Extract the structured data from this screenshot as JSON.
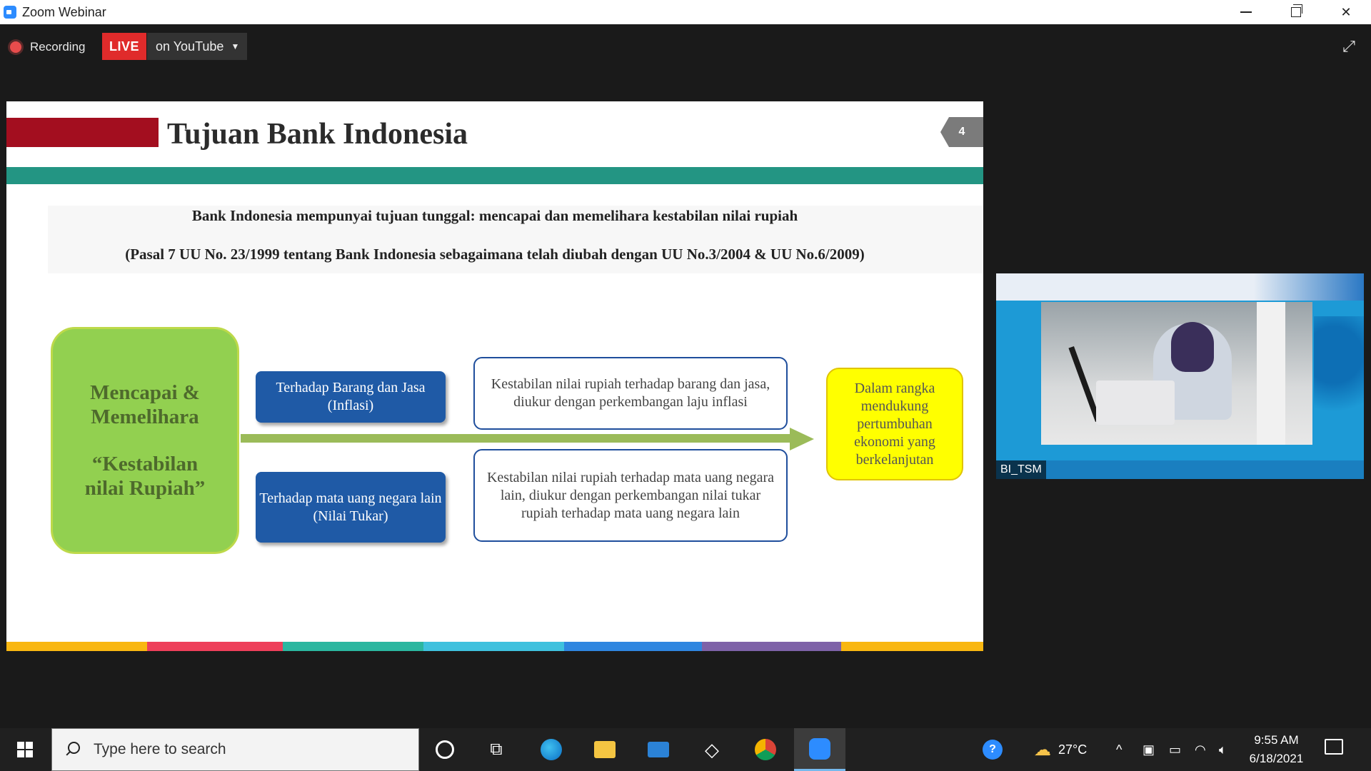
{
  "window": {
    "title": "Zoom Webinar"
  },
  "toolbar": {
    "recording_label": "Recording",
    "live_label": "LIVE",
    "stream_target": "on YouTube"
  },
  "slide": {
    "title": "Tujuan Bank Indonesia",
    "page_number": "4",
    "statement": "Bank Indonesia mempunyai tujuan tunggal: mencapai dan memelihara kestabilan nilai rupiah",
    "legal_basis": "(Pasal 7 UU No. 23/1999 tentang Bank Indonesia sebagaimana telah diubah dengan UU No.3/2004 & UU No.6/2009)",
    "goal_line1": "Mencapai &",
    "goal_line2": "Memelihara",
    "goal_line3": "“Kestabilan",
    "goal_line4": "nilai Rupiah”",
    "aspect_goods": "Terhadap Barang dan Jasa (Inflasi)",
    "aspect_currency": "Terhadap mata uang negara lain (Nilai Tukar)",
    "desc_goods": "Kestabilan nilai rupiah terhadap barang dan jasa, diukur dengan perkembangan laju inflasi",
    "desc_currency": "Kestabilan nilai rupiah terhadap mata uang negara lain, diukur dengan perkembangan nilai tukar rupiah terhadap mata uang negara lain",
    "outcome": "Dalam rangka mendukung pertumbuhan ekonomi yang berkelanjutan",
    "stripe_colors": [
      "#f9b711",
      "#ee3f5a",
      "#2bb7a0",
      "#3fc1de",
      "#2f86e0",
      "#7e62a8",
      "#f9b711"
    ]
  },
  "video": {
    "participant": "BI_TSM"
  },
  "taskbar": {
    "search_placeholder": "Type here to search",
    "temperature": "27°C",
    "time": "9:55 AM",
    "date": "6/18/2021"
  }
}
